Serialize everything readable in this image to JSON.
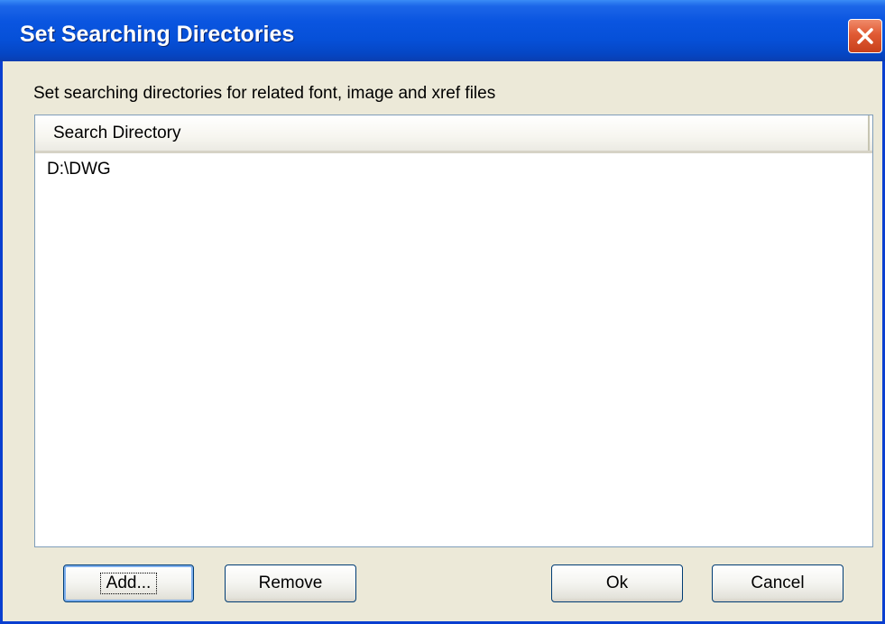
{
  "window": {
    "title": "Set Searching Directories",
    "close_icon": "close-icon"
  },
  "description": "Set searching directories for related font, image and xref files",
  "list": {
    "column_header": "Search Directory",
    "rows": [
      "D:\\DWG"
    ]
  },
  "buttons": {
    "add": "Add...",
    "remove": "Remove",
    "ok": "Ok",
    "cancel": "Cancel"
  },
  "colors": {
    "titlebar": "#0a55e0",
    "close_button": "#e05a33",
    "dialog_background": "#ece9d8"
  }
}
